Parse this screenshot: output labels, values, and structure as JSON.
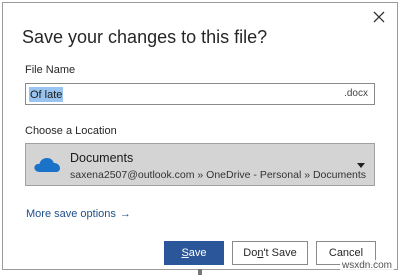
{
  "dialog": {
    "title": "Save your changes to this file?",
    "close_icon": "close-icon"
  },
  "file_name": {
    "label": "File Name",
    "value": "Of late",
    "extension": ".docx"
  },
  "location": {
    "label": "Choose a Location",
    "icon": "onedrive-cloud-icon",
    "name": "Documents",
    "path": "saxena2507@outlook.com » OneDrive - Personal » Documents"
  },
  "more_options": {
    "label": "More save options",
    "arrow": "→"
  },
  "buttons": {
    "save": {
      "pre": "",
      "ul": "S",
      "post": "ave"
    },
    "dont_save": {
      "pre": "Do",
      "ul": "n",
      "post": "'t Save"
    },
    "cancel": {
      "label": "Cancel"
    }
  },
  "colors": {
    "primary": "#2b579a",
    "link": "#1e4e8c",
    "selection": "#99c4f0",
    "location_bg": "#d4d4d4"
  },
  "watermark": "wsxdn.com"
}
